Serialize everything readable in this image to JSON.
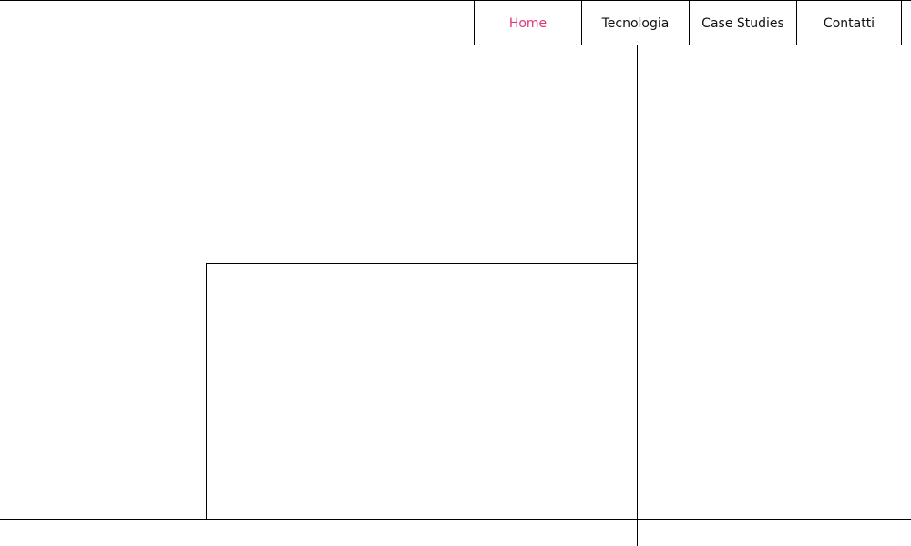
{
  "header": {
    "nav": [
      {
        "label": "Home",
        "active": true
      },
      {
        "label": "Tecnologia",
        "active": false
      },
      {
        "label": "Case Studies",
        "active": false
      },
      {
        "label": "Contatti",
        "active": false
      }
    ]
  },
  "colors": {
    "accent": "#e0357a",
    "text": "#111111",
    "border": "#000000",
    "background": "#ffffff"
  }
}
